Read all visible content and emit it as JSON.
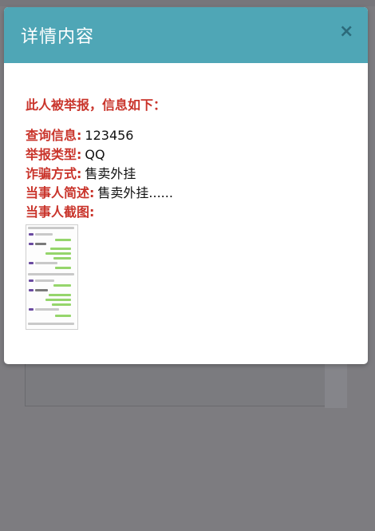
{
  "modal": {
    "title": "详情内容",
    "close_icon": "×",
    "headline": "此人被举报，信息如下：",
    "fields": [
      {
        "label": "查询信息:",
        "value": "123456"
      },
      {
        "label": "举报类型:",
        "value": "QQ"
      },
      {
        "label": "诈骗方式:",
        "value": "售卖外挂"
      },
      {
        "label": "当事人简述:",
        "value": "售卖外挂......"
      },
      {
        "label": "当事人截图:",
        "value": ""
      }
    ]
  },
  "colors": {
    "header": "#4fa6b6",
    "label_red": "#c9342b",
    "overlay": "#7d7c80"
  }
}
